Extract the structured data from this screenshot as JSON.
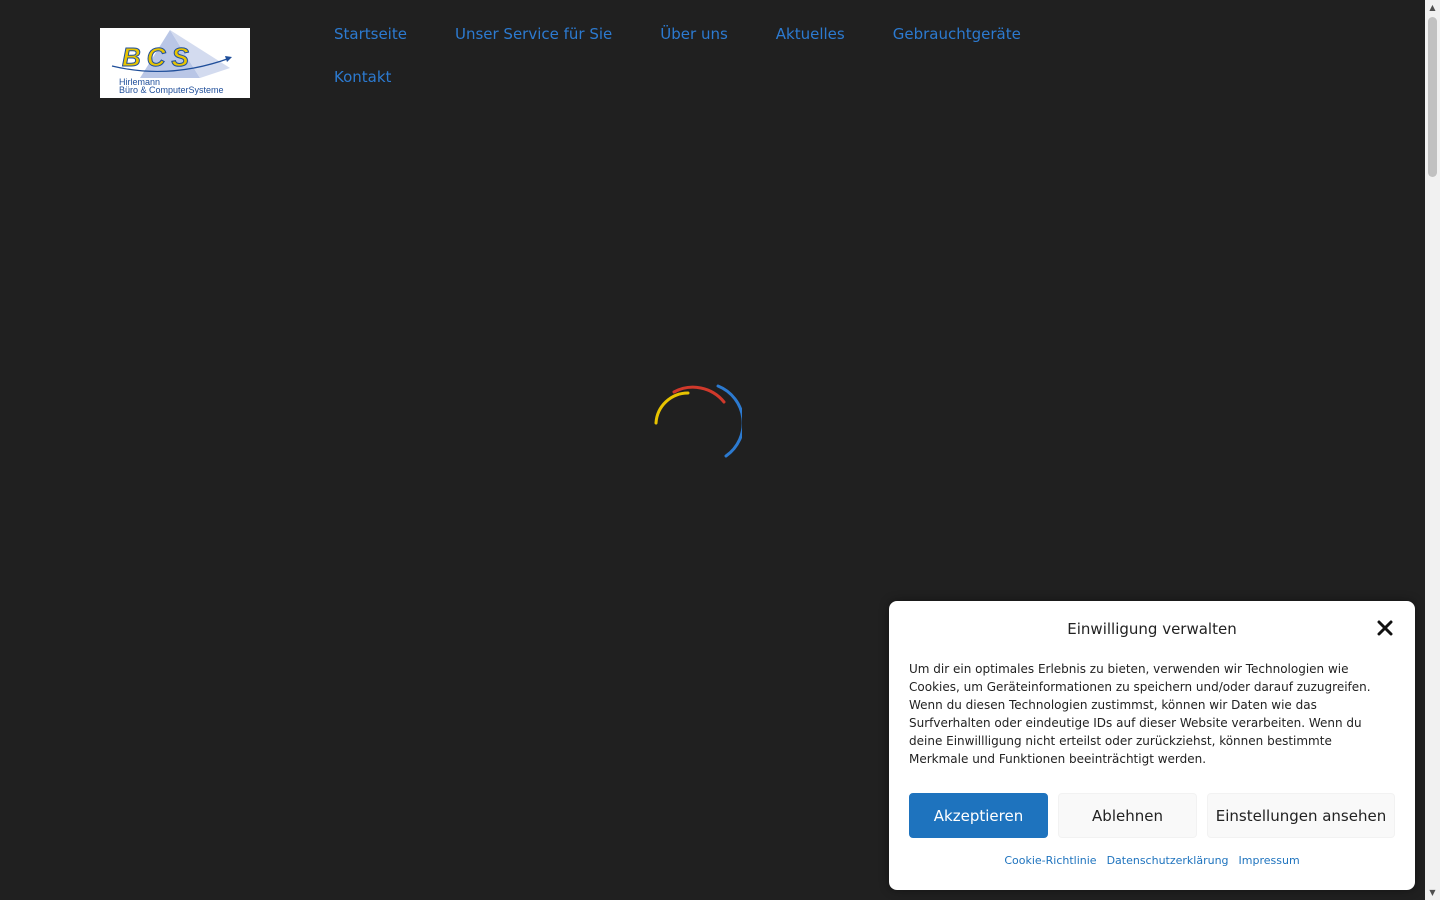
{
  "logo": {
    "letters": "BCS",
    "line1": "Hirlemann",
    "line2": "Büro & ComputerSysteme",
    "brand_blue": "#1f4e9a",
    "brand_yellow": "#e8c400"
  },
  "nav": {
    "items": [
      {
        "label": "Startseite"
      },
      {
        "label": "Unser Service für Sie"
      },
      {
        "label": "Über uns"
      },
      {
        "label": "Aktuelles"
      },
      {
        "label": "Gebrauchtgeräte"
      },
      {
        "label": "Kontakt"
      }
    ],
    "link_color": "#2c7ad0"
  },
  "spinner": {
    "icon": "loading-spinner-icon",
    "colors": [
      "#d0392b",
      "#2c7ad0",
      "#e8c400"
    ]
  },
  "cookie_banner": {
    "title": "Einwilligung verwalten",
    "close_icon": "close-icon",
    "text": "Um dir ein optimales Erlebnis zu bieten, verwenden wir Technologien wie Cookies, um Geräteinformationen zu speichern und/oder darauf zuzugreifen. Wenn du diesen Technologien zustimmst, können wir Daten wie das Surfverhalten oder eindeutige IDs auf dieser Website verarbeiten. Wenn du deine Einwillligung nicht erteilst oder zurückziehst, können bestimmte Merkmale und Funktionen beeinträchtigt werden.",
    "buttons": {
      "accept": "Akzeptieren",
      "deny": "Ablehnen",
      "settings": "Einstellungen ansehen"
    },
    "links": {
      "cookie_policy": "Cookie-Richtlinie",
      "privacy": "Datenschutzerklärung",
      "imprint": "Impressum"
    },
    "accent_color": "#1e73be"
  },
  "colors": {
    "background": "#202020"
  }
}
